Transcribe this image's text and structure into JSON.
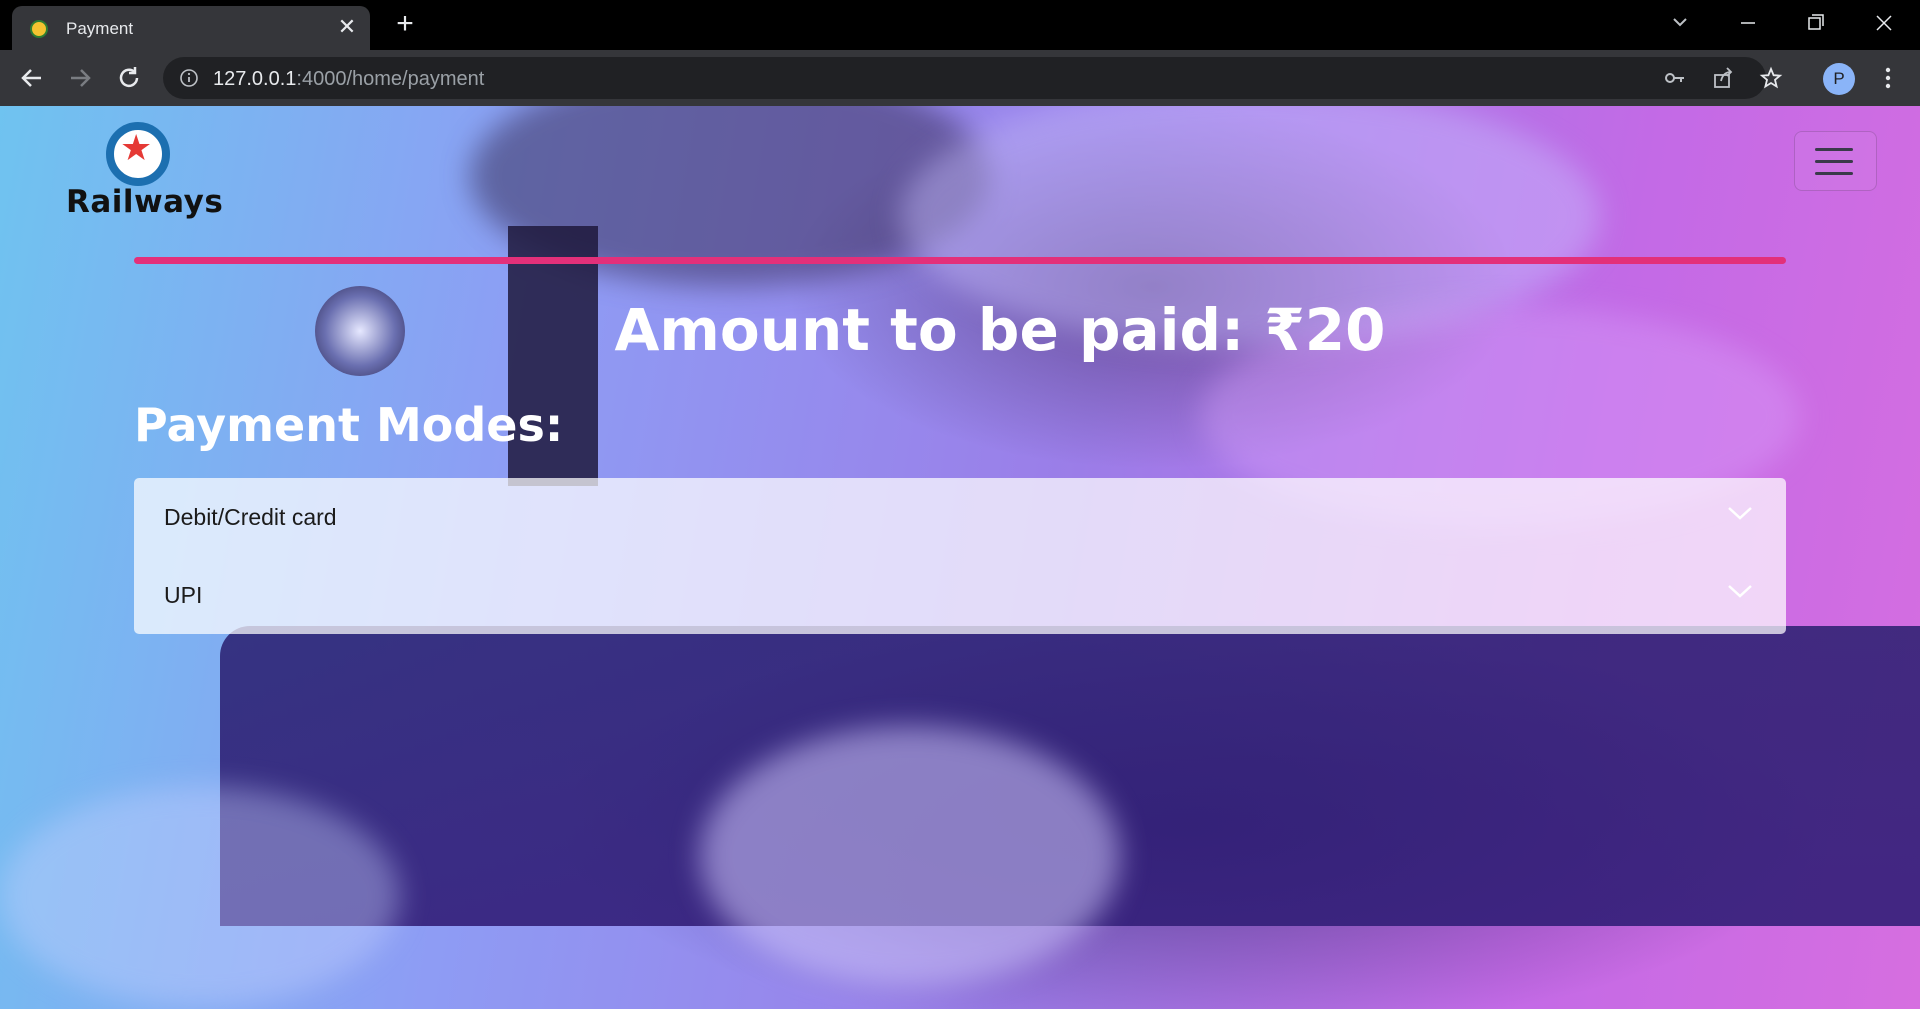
{
  "browser": {
    "tab_title": "Payment",
    "url_host": "127.0.0.1",
    "url_rest": ":4000/home/payment",
    "profile_initial": "P"
  },
  "page": {
    "logo_text": "Railways",
    "amount_text": "Amount to be paid: ₹20",
    "modes_title": "Payment Modes:",
    "payment_modes": [
      {
        "label": "Debit/Credit card"
      },
      {
        "label": "UPI"
      }
    ],
    "accent_color": "#e3307a"
  }
}
